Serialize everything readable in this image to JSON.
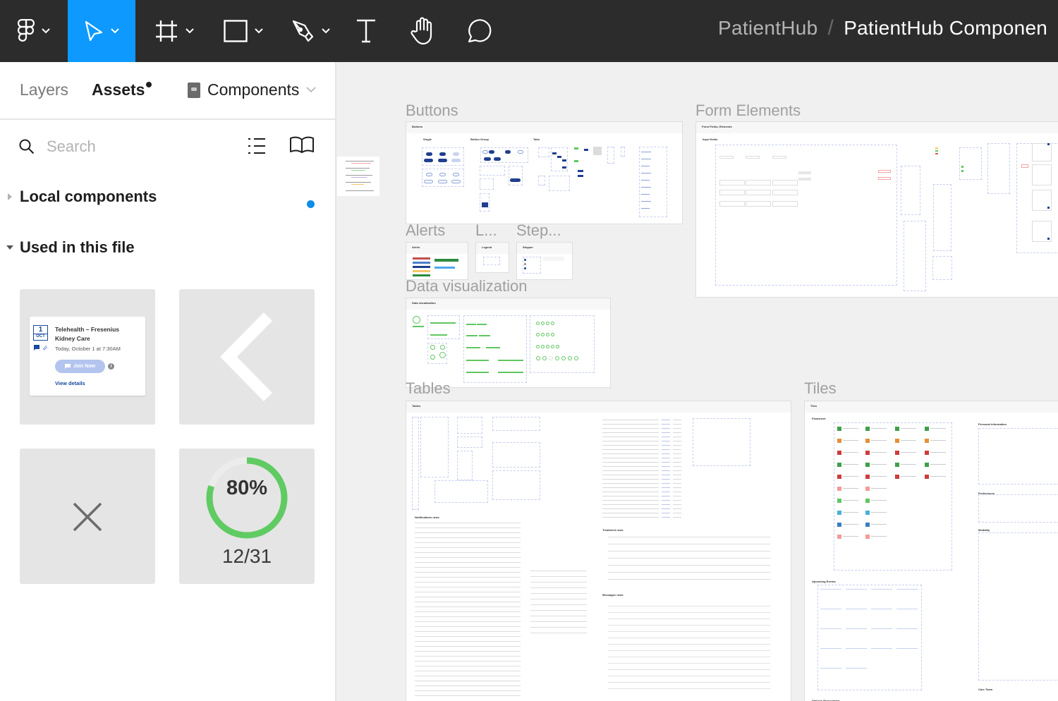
{
  "toolbar": {
    "tools": [
      {
        "name": "main-menu",
        "icon": "figma-logo-icon",
        "has_dropdown": true,
        "active": false
      },
      {
        "name": "move",
        "icon": "cursor-arrow-icon",
        "has_dropdown": true,
        "active": true
      },
      {
        "name": "frame",
        "icon": "frame-hash-icon",
        "has_dropdown": true,
        "active": false
      },
      {
        "name": "shape",
        "icon": "rectangle-icon",
        "has_dropdown": true,
        "active": false
      },
      {
        "name": "pen",
        "icon": "pen-nib-icon",
        "has_dropdown": true,
        "active": false
      },
      {
        "name": "text",
        "icon": "text-t-icon",
        "has_dropdown": false,
        "active": false
      },
      {
        "name": "hand",
        "icon": "hand-icon",
        "has_dropdown": false,
        "active": false
      },
      {
        "name": "comment",
        "icon": "comment-bubble-icon",
        "has_dropdown": false,
        "active": false
      }
    ],
    "active_color": "#0d99ff",
    "breadcrumb": {
      "project": "PatientHub",
      "separator": "/",
      "file": "PatientHub Componen"
    }
  },
  "sidebar": {
    "tabs": {
      "layers": "Layers",
      "assets": "Assets"
    },
    "library_select": "Components",
    "search": {
      "placeholder": "Search",
      "value": ""
    },
    "sections": {
      "local": "Local components",
      "used": "Used in this file"
    },
    "thumbnails": {
      "event_card": {
        "cal_day": "1",
        "cal_month": "OCT",
        "title": "Telehealth – Fresenius Kidney Care",
        "time": "Today, October 1 at 7:30AM",
        "join_label": "Join Now",
        "info": "i",
        "view_details": "View details"
      },
      "chevron": "chevron-left-icon",
      "close": "close-x-icon",
      "progress": {
        "percent_label": "80%",
        "fraction": 0.8,
        "count_label": "12/31"
      }
    }
  },
  "canvas": {
    "frames": [
      {
        "id": "buttons",
        "label": "Buttons",
        "header": "Buttons"
      },
      {
        "id": "form",
        "label": "Form Elements",
        "header": "Form Fields, Elements"
      },
      {
        "id": "alerts",
        "label": "Alerts",
        "header": "Alerts"
      },
      {
        "id": "legend",
        "label": "L...",
        "header": "Legend"
      },
      {
        "id": "stepper",
        "label": "Step...",
        "header": "Stepper"
      },
      {
        "id": "dataviz",
        "label": "Data visualization",
        "header": "Data visualization"
      },
      {
        "id": "tables",
        "label": "Tables",
        "header": "Tables"
      },
      {
        "id": "tiles",
        "label": "Tiles",
        "header": "Tiles"
      }
    ],
    "subsections": {
      "buttons": [
        "Single",
        "Button Group",
        "Tabs"
      ],
      "form": [
        "Input fields"
      ],
      "tables": [
        "Notifications rows",
        "Treatment rows",
        "Messages rows"
      ],
      "tiles": [
        "Flowsheet",
        "Personal information",
        "Preferences",
        "Upcoming Events",
        "Modality",
        "Care Team",
        "Dialysis Prescription"
      ]
    }
  }
}
